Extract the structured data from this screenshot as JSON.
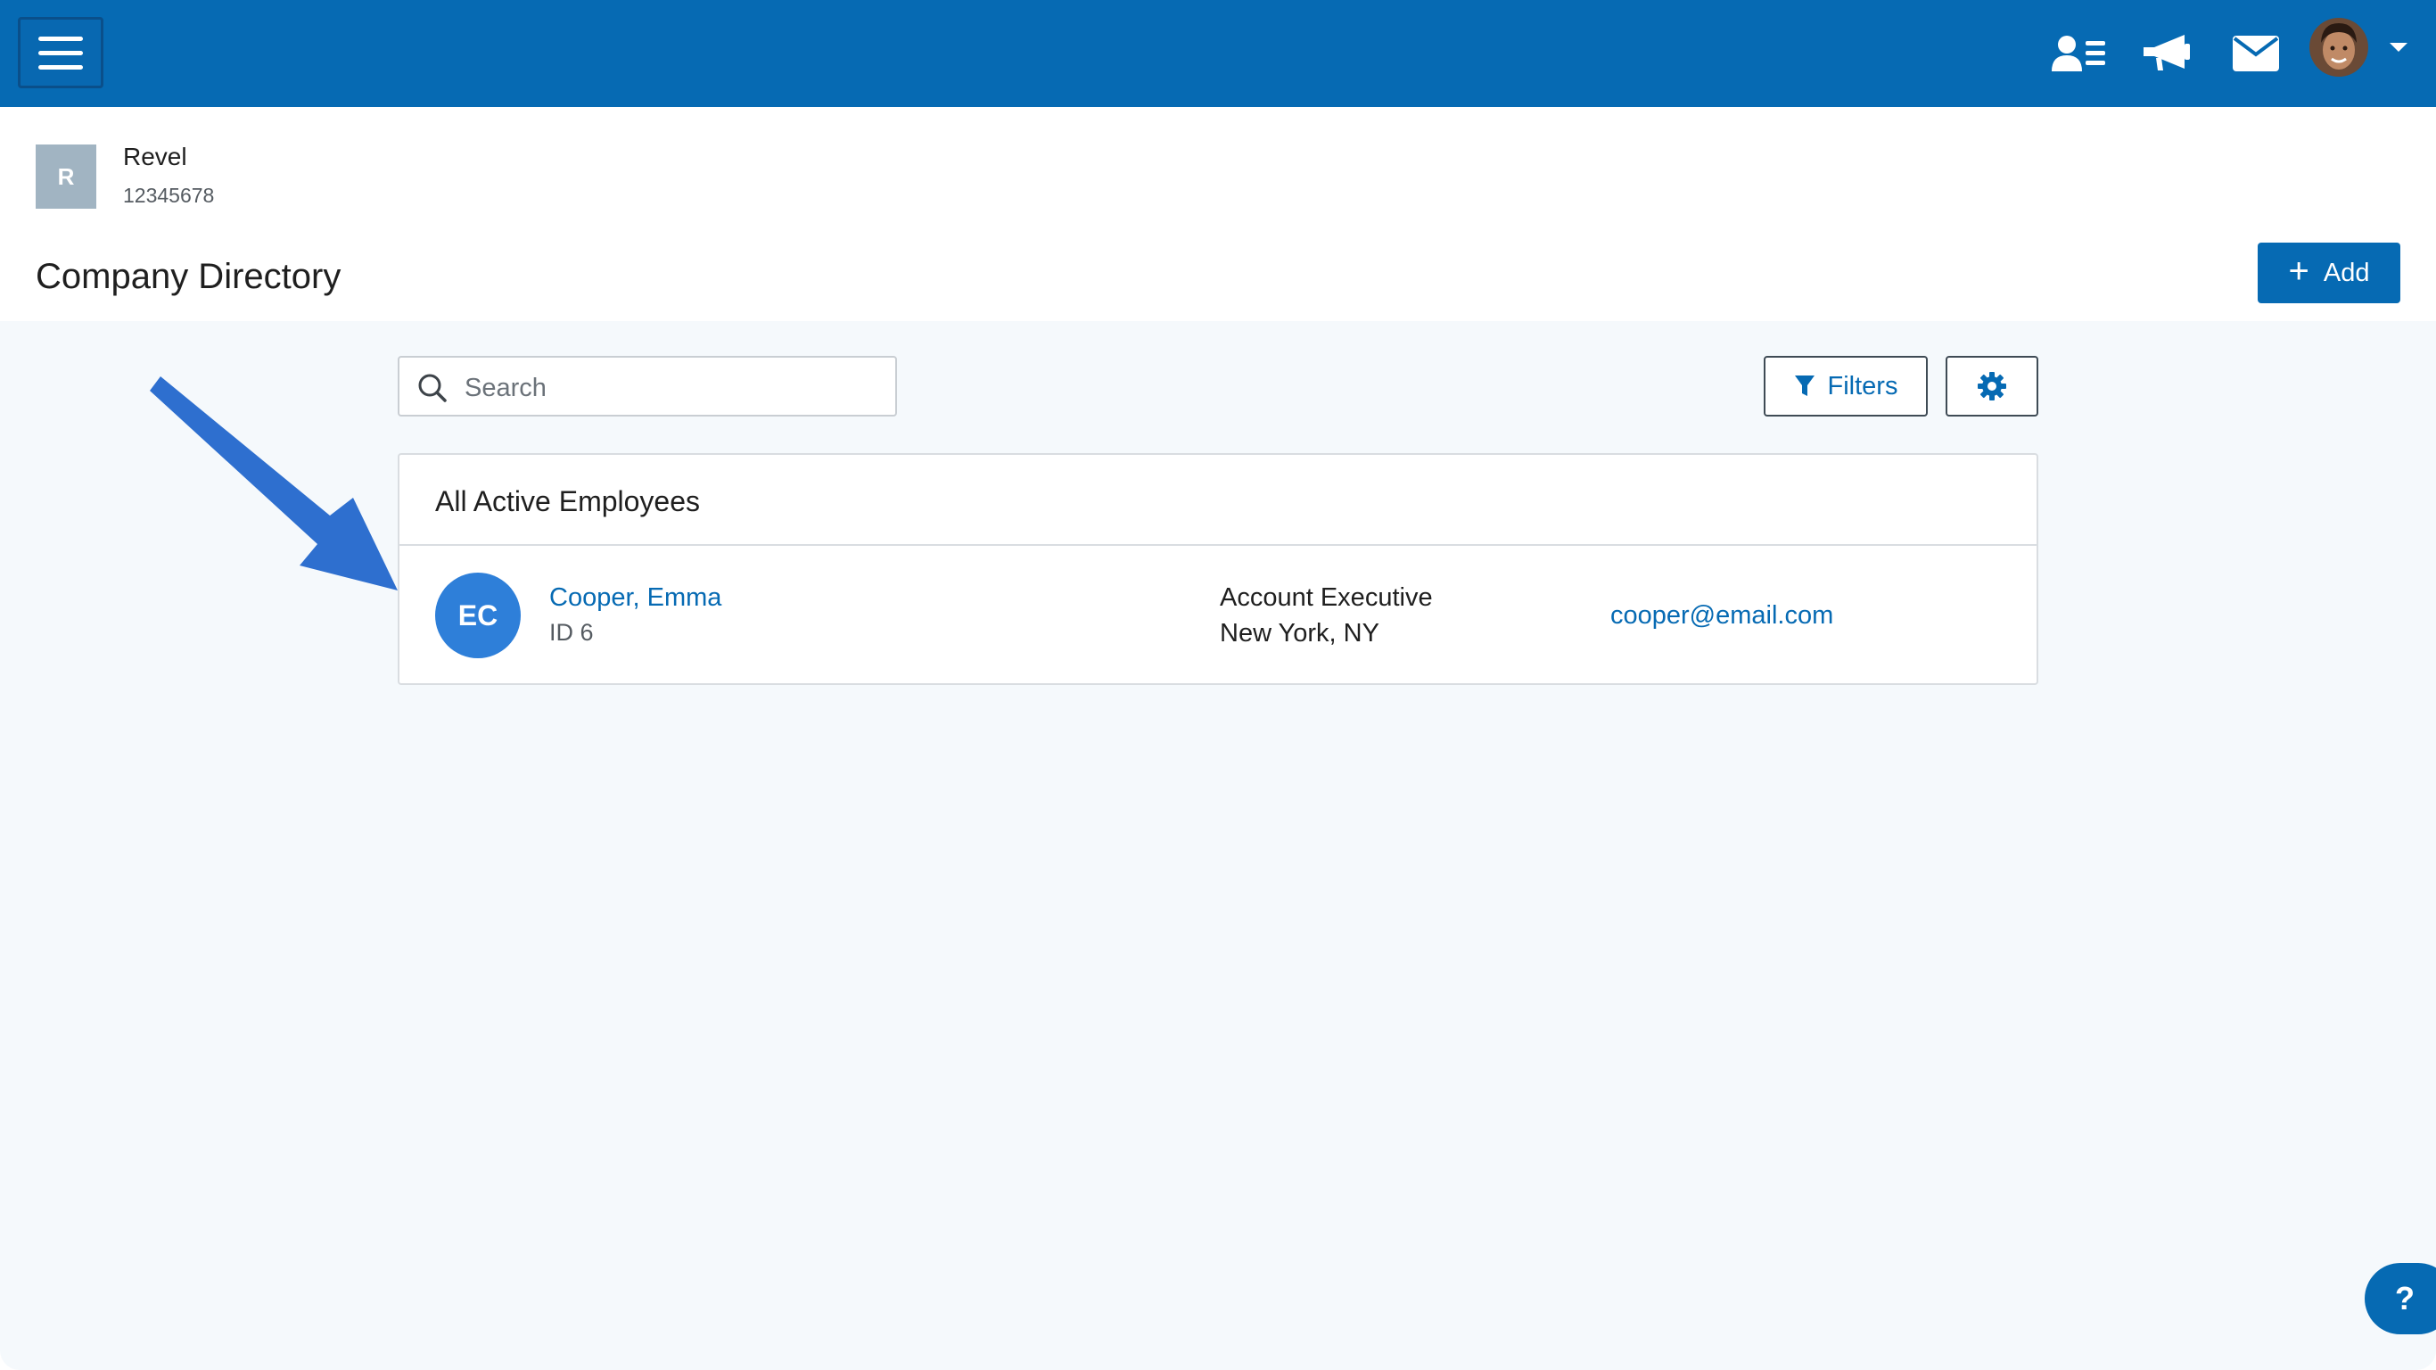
{
  "topbar": {
    "menu_icon": "hamburger-icon",
    "icons": [
      "directory-icon",
      "megaphone-icon",
      "envelope-icon"
    ],
    "avatar_icon": "user-avatar",
    "caret_icon": "caret-down-icon",
    "brand_color": "#066ab3"
  },
  "company": {
    "badge_letter": "R",
    "name": "Revel",
    "id": "12345678"
  },
  "page": {
    "title": "Company Directory",
    "add_label": "Add"
  },
  "search": {
    "placeholder": "Search"
  },
  "toolbar": {
    "filters_label": "Filters",
    "settings_icon": "gear-icon"
  },
  "list": {
    "title": "All Active Employees",
    "employees": [
      {
        "initials": "EC",
        "name": "Cooper, Emma",
        "id": "ID 6",
        "job_title": "Account Executive",
        "location": "New York, NY",
        "email": "cooper@email.com"
      }
    ]
  },
  "help": {
    "label": "?"
  }
}
